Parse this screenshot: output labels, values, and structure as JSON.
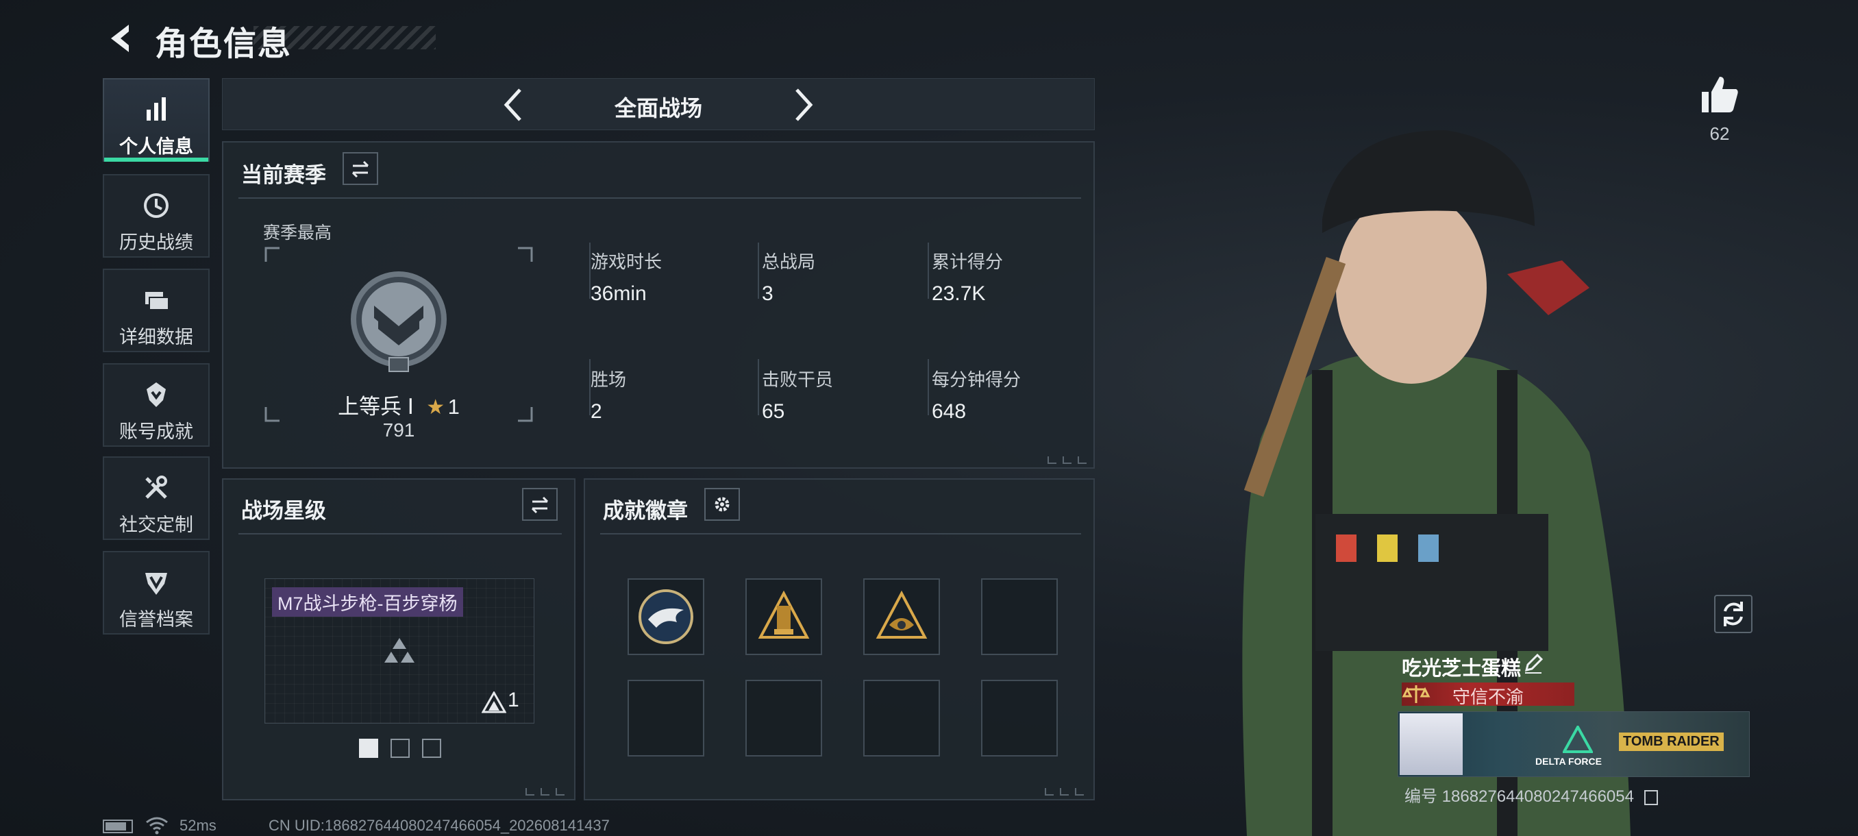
{
  "header": {
    "title": "角色信息"
  },
  "sidebar": {
    "items": [
      {
        "label": "个人信息",
        "icon": "bar-chart-icon",
        "active": true
      },
      {
        "label": "历史战绩",
        "icon": "history-clock-icon"
      },
      {
        "label": "详细数据",
        "icon": "folder-icon"
      },
      {
        "label": "账号成就",
        "icon": "achievement-icon"
      },
      {
        "label": "社交定制",
        "icon": "tools-icon"
      },
      {
        "label": "信誉档案",
        "icon": "shield-badge-icon"
      }
    ]
  },
  "mode": {
    "title": "全面战场"
  },
  "season": {
    "title": "当前赛季",
    "best_label": "赛季最高",
    "rank_name": "上等兵 Ⅰ",
    "rank_stars": "1",
    "rank_points": "791",
    "stats": [
      {
        "label": "游戏时长",
        "value": "36min"
      },
      {
        "label": "总战局",
        "value": "3"
      },
      {
        "label": "累计得分",
        "value": "23.7K"
      },
      {
        "label": "胜场",
        "value": "2"
      },
      {
        "label": "击败干员",
        "value": "65"
      },
      {
        "label": "每分钟得分",
        "value": "648"
      }
    ]
  },
  "star_level": {
    "title": "战场星级",
    "weapon_tag": "M7战斗步枪-百步穿杨",
    "weapon_level": "1"
  },
  "badges": {
    "title": "成就徽章"
  },
  "profile": {
    "likes": "62",
    "name": "吃光芝士蛋糕",
    "honor": "守信不渝",
    "banner_text_1": "DELTA FORCE",
    "banner_text_2": "TOMB RAIDER",
    "id_line": "编号 1868276440802474660​54"
  },
  "status": {
    "ping": "52ms",
    "uid": "CN UID:18682764408024746605​4_202608141437"
  },
  "colors": {
    "accent": "#3bd9a4",
    "honor": "#a82828",
    "gold": "#d9a84a"
  }
}
